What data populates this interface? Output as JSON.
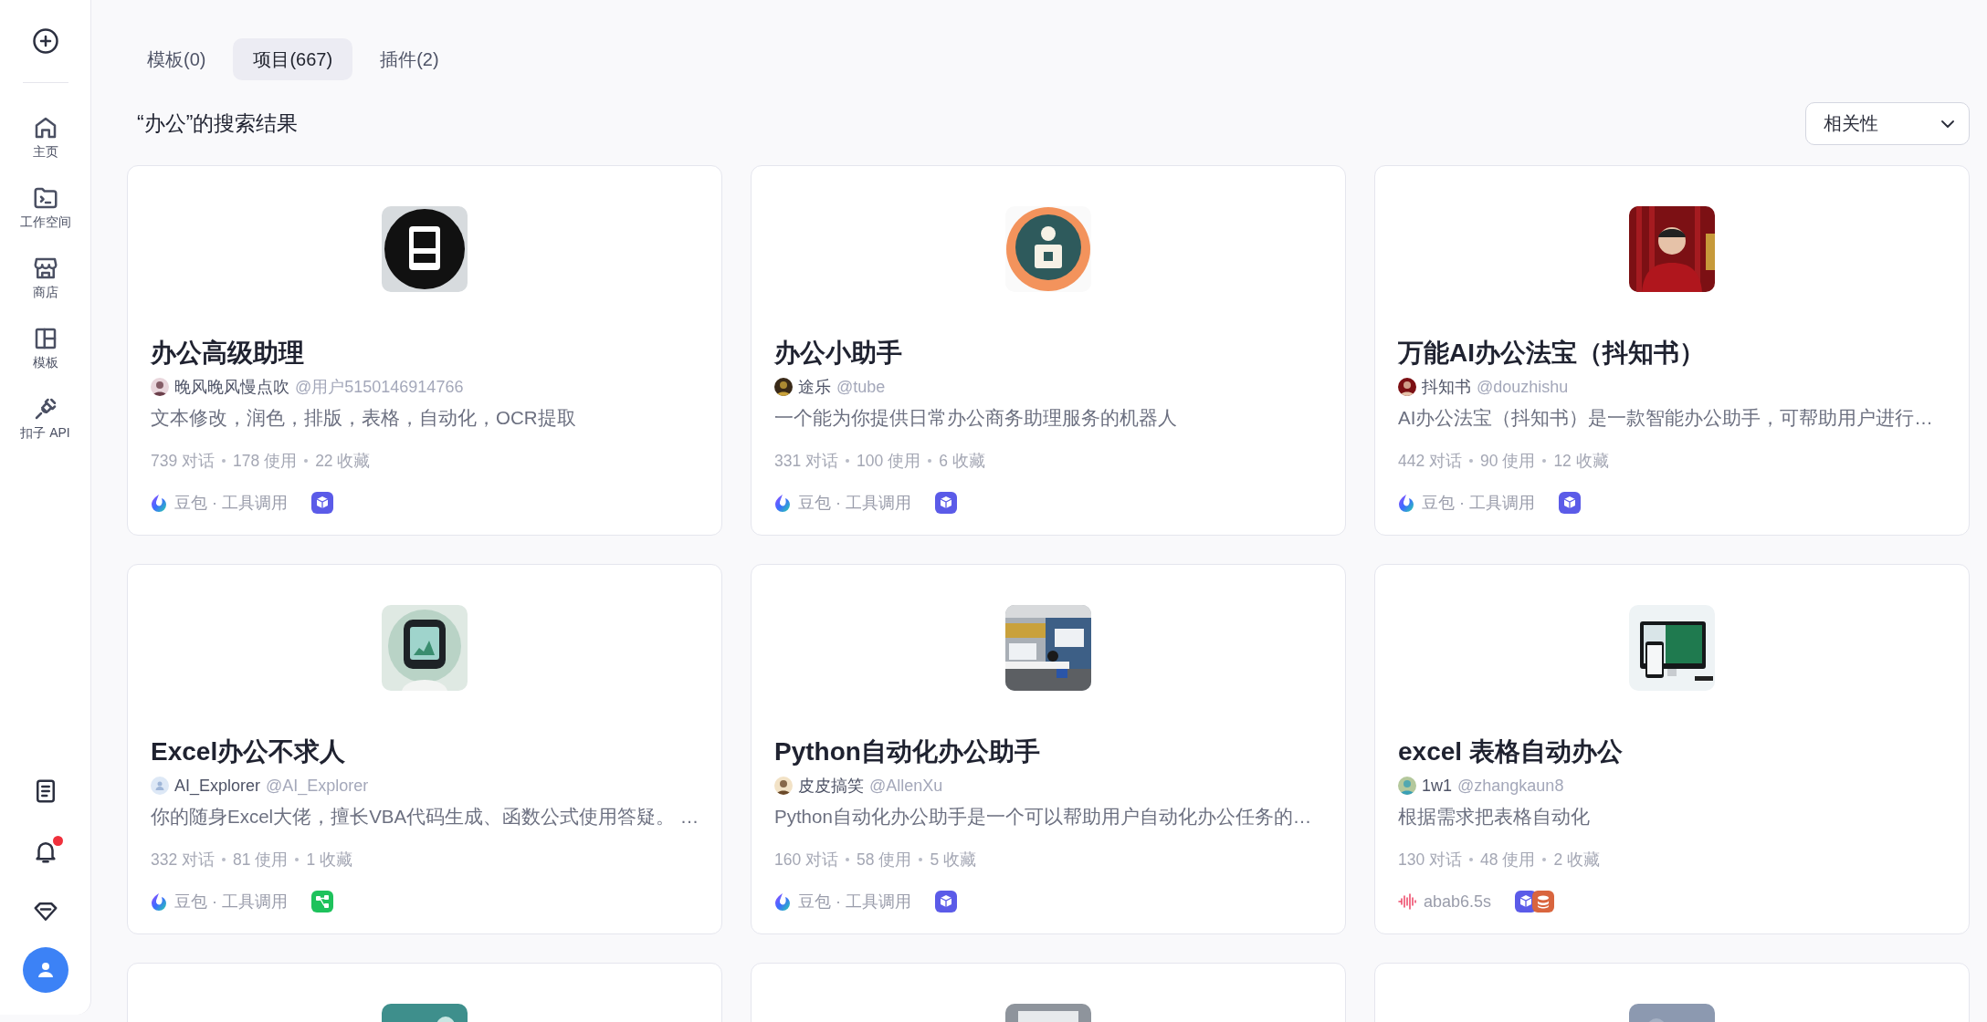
{
  "sidebar": {
    "create_button": {
      "kind": "plus"
    },
    "items": [
      {
        "kind": "home",
        "label": "主页"
      },
      {
        "kind": "workspace",
        "label": "工作空间"
      },
      {
        "kind": "store",
        "label": "商店"
      },
      {
        "kind": "template",
        "label": "模板"
      },
      {
        "kind": "api",
        "label": "扣子 API"
      }
    ],
    "bottom": [
      {
        "kind": "docs",
        "unread": false
      },
      {
        "kind": "bell",
        "unread": true
      },
      {
        "kind": "diamond",
        "unread": false
      },
      {
        "kind": "avatar",
        "unread": false
      }
    ]
  },
  "tabs": [
    {
      "label": "模板(0)",
      "selected": false
    },
    {
      "label": "项目(667)",
      "selected": true
    },
    {
      "label": "插件(2)",
      "selected": false
    }
  ],
  "heading": "“办公”的搜索结果",
  "sort": {
    "value": "相关性"
  },
  "cards": [
    {
      "avatar": {
        "kind": "picture"
      },
      "title": "办公高级助理",
      "author": {
        "default_avatar": false,
        "name": "晚风晚风慢点吹",
        "handle": "@用户5150146914766"
      },
      "description": "文本修改，润色，排版，表格，自动化，OCR提取",
      "stats": [
        "739 对话",
        "178 使用",
        "22 收藏"
      ],
      "model": {
        "kind": "doubao",
        "label": "豆包 · 工具调用"
      },
      "plugins": [
        {
          "kind": "cube"
        }
      ]
    },
    {
      "avatar": {
        "kind": "picture"
      },
      "title": "办公小助手",
      "author": {
        "default_avatar": false,
        "name": "途乐",
        "handle": "@tube"
      },
      "description": "一个能为你提供日常办公商务助理服务的机器人",
      "stats": [
        "331 对话",
        "100 使用",
        "6 收藏"
      ],
      "model": {
        "kind": "doubao",
        "label": "豆包 · 工具调用"
      },
      "plugins": [
        {
          "kind": "cube"
        }
      ]
    },
    {
      "avatar": {
        "kind": "picture"
      },
      "title": "万能AI办公法宝（抖知书）",
      "author": {
        "default_avatar": false,
        "name": "抖知书",
        "handle": "@douzhishu"
      },
      "description": "AI办公法宝（抖知书）是一款智能办公助手，可帮助用户进行…",
      "stats": [
        "442 对话",
        "90 使用",
        "12 收藏"
      ],
      "model": {
        "kind": "doubao",
        "label": "豆包 · 工具调用"
      },
      "plugins": [
        {
          "kind": "cube"
        }
      ]
    },
    {
      "avatar": {
        "kind": "picture"
      },
      "title": "Excel办公不求人",
      "author": {
        "default_avatar": true,
        "name": "AI_Explorer",
        "handle": "@AI_Explorer"
      },
      "description": "你的随身Excel大佬，擅长VBA代码生成、函数公式使用答疑。 …",
      "stats": [
        "332 对话",
        "81 使用",
        "1 收藏"
      ],
      "model": {
        "kind": "doubao",
        "label": "豆包 · 工具调用"
      },
      "plugins": [
        {
          "kind": "flow"
        }
      ]
    },
    {
      "avatar": {
        "kind": "picture"
      },
      "title": "Python自动化办公助手",
      "author": {
        "default_avatar": false,
        "name": "皮皮搞笑",
        "handle": "@AllenXu"
      },
      "description": "Python自动化办公助手是一个可以帮助用户自动化办公任务的…",
      "stats": [
        "160 对话",
        "58 使用",
        "5 收藏"
      ],
      "model": {
        "kind": "doubao",
        "label": "豆包 · 工具调用"
      },
      "plugins": [
        {
          "kind": "cube"
        }
      ]
    },
    {
      "avatar": {
        "kind": "picture"
      },
      "title": "excel 表格自动办公",
      "author": {
        "default_avatar": false,
        "name": "1w1",
        "handle": "@zhangkaun8"
      },
      "description": "根据需求把表格自动化",
      "stats": [
        "130 对话",
        "48 使用",
        "2 收藏"
      ],
      "model": {
        "kind": "wave",
        "label": "abab6.5s"
      },
      "plugins": [
        {
          "kind": "cube"
        },
        {
          "kind": "database"
        }
      ]
    },
    {
      "avatar": {
        "kind": "picture"
      }
    },
    {
      "avatar": {
        "kind": "picture"
      }
    },
    {
      "avatar": {
        "kind": "picture"
      }
    }
  ]
}
